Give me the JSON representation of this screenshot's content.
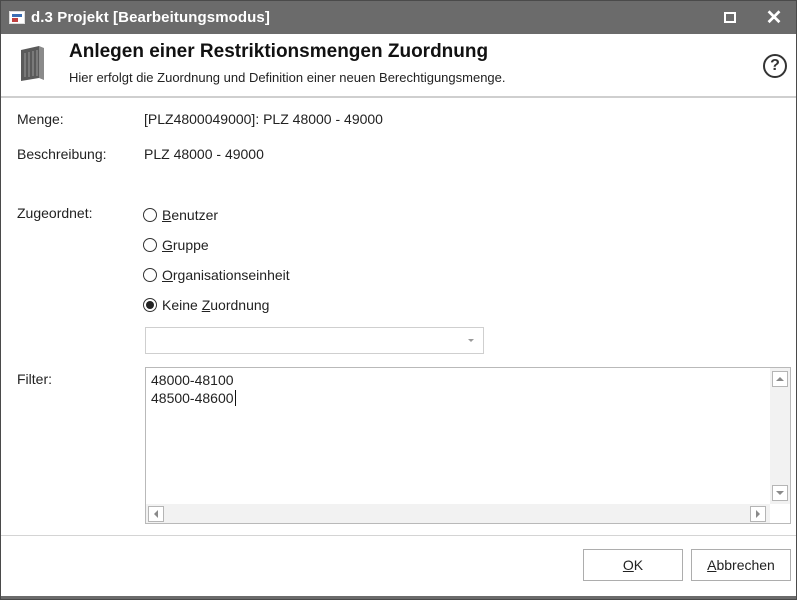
{
  "window": {
    "title": "d.3 Projekt [Bearbeitungsmodus]"
  },
  "header": {
    "title": "Anlegen einer Restriktionsmengen Zuordnung",
    "subtitle": "Hier erfolgt die Zuordnung und Definition einer neuen Berechtigungsmenge.",
    "help_symbol": "?"
  },
  "form": {
    "menge_label": "Menge:",
    "menge_value": "[PLZ4800049000]: PLZ 48000 - 49000",
    "beschreibung_label": "Beschreibung:",
    "beschreibung_value": "PLZ 48000 - 49000",
    "zugeordnet_label": "Zugeordnet:",
    "radio_options": [
      {
        "accel": "B",
        "rest": "enutzer",
        "prefix": "",
        "selected": false
      },
      {
        "accel": "G",
        "rest": "ruppe",
        "prefix": "",
        "selected": false
      },
      {
        "accel": "O",
        "rest": "rganisationseinheit",
        "prefix": "",
        "selected": false
      },
      {
        "accel": "Z",
        "rest": "uordnung",
        "prefix": "Keine ",
        "selected": true
      }
    ],
    "assignment_select_value": "",
    "filter_label": "Filter:",
    "filter_value": "48000-48100\n48500-48600"
  },
  "buttons": {
    "ok_accel": "O",
    "ok_rest": "K",
    "cancel_accel": "A",
    "cancel_rest": "bbrechen"
  },
  "colors": {
    "titlebar": "#6b6b6b",
    "accent_text": "#111111"
  },
  "icons": {
    "window": "app-window-icon",
    "header": "book-icon",
    "help": "help-circle-icon",
    "maximize": "maximize-icon",
    "close": "close-icon"
  }
}
